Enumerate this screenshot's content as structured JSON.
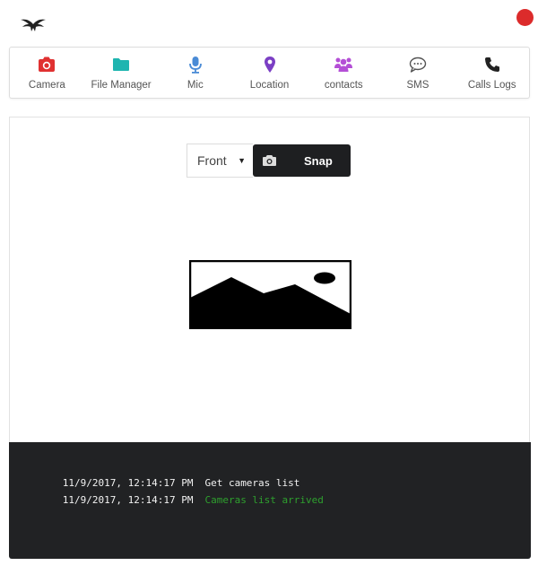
{
  "colors": {
    "status_dot": "#dc2b2b",
    "camera_icon": "#e03131",
    "file_manager_icon": "#1fb5b0",
    "mic_icon": "#4a8bd6",
    "location_icon": "#7b3fc4",
    "contacts_icon": "#b44fd6",
    "sms_icon": "#555555",
    "calls_icon": "#222222",
    "console_bg": "#212224",
    "log_default": "#f2f2f2",
    "log_success": "#2ea02e"
  },
  "header": {
    "logo_icon": "bird-logo-icon",
    "status_icon": "record-dot-icon"
  },
  "nav": {
    "items": [
      {
        "label": "Camera",
        "icon": "camera-icon"
      },
      {
        "label": "File Manager",
        "icon": "folder-icon"
      },
      {
        "label": "Mic",
        "icon": "microphone-icon"
      },
      {
        "label": "Location",
        "icon": "map-marker-icon"
      },
      {
        "label": "contacts",
        "icon": "users-icon"
      },
      {
        "label": "SMS",
        "icon": "chat-bubble-icon"
      },
      {
        "label": "Calls Logs",
        "icon": "phone-icon"
      }
    ]
  },
  "camera": {
    "selected_camera": "Front",
    "snap_label": "Snap",
    "snap_icon": "camera-icon",
    "preview_icon": "image-placeholder-icon"
  },
  "console": {
    "lines": [
      {
        "time": "11/9/2017, 12:14:17 PM",
        "message": "Get cameras list",
        "status": "default"
      },
      {
        "time": "11/9/2017, 12:14:17 PM",
        "message": "Cameras list arrived",
        "status": "success"
      }
    ]
  }
}
